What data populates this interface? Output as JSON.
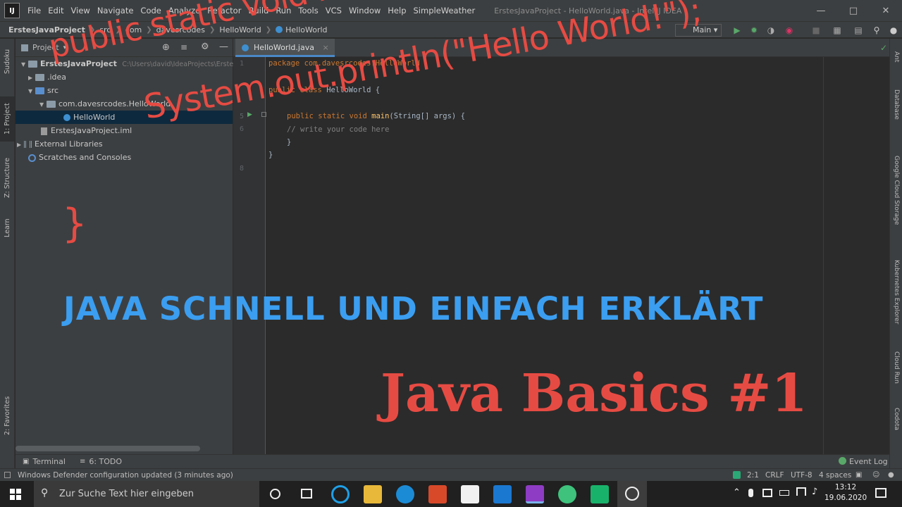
{
  "menu": [
    "File",
    "Edit",
    "View",
    "Navigate",
    "Code",
    "Analyze",
    "Refactor",
    "Build",
    "Run",
    "Tools",
    "VCS",
    "Window",
    "Help",
    "SimpleWeather"
  ],
  "window_title": "ErstesJavaProject - HelloWorld.java - IntelliJ IDEA",
  "app_logo": "IJ",
  "breadcrumbs": [
    "ErstesJavaProject",
    "src",
    "com",
    "davesrcodes",
    "HelloWorld",
    "HelloWorld"
  ],
  "run_config": "Main",
  "left_tabs": [
    "Sudoku",
    "1: Project",
    "Z: Structure",
    "Learn",
    "2: Favorites"
  ],
  "right_tabs": [
    "Ant",
    "Database",
    "Google Cloud Storage",
    "Kubernetes Explorer",
    "Cloud Run",
    "Codota"
  ],
  "project_panel": {
    "title": "Project",
    "tree": [
      {
        "label": "ErstesJavaProject",
        "path": "C:\\Users\\david\\IdeaProjects\\ErstesJ"
      },
      {
        "label": ".idea"
      },
      {
        "label": "src"
      },
      {
        "label": "com.davesrcodes.HelloWorld"
      },
      {
        "label": "HelloWorld"
      },
      {
        "label": "ErstesJavaProject.iml"
      },
      {
        "label": "External Libraries"
      },
      {
        "label": "Scratches and Consoles"
      }
    ]
  },
  "editor": {
    "tab": "HelloWorld.java",
    "line_numbers": [
      "1",
      "5",
      "6",
      "8"
    ],
    "lines": {
      "package": "package com.davesrcodes.HelloWorld",
      "class_kw": "public class",
      "class_name": "HelloWorld {",
      "main_kw": "public static void",
      "main_name": "main",
      "main_args": "(String[] args) {",
      "comment": "// write your code here",
      "close_inner": "}",
      "close_outer": "}"
    }
  },
  "overlay": {
    "line1": "public static void main(String[] args) {",
    "line2": "System.out.println(\"Hello World!\");",
    "brace": "}",
    "subtitle": "JAVA SCHNELL UND EINFACH ERKLÄRT",
    "headline": "Java Basics #1",
    "red": "#e64b43",
    "blue": "#3b9ef0"
  },
  "bottom_tools": {
    "terminal": "Terminal",
    "todo": "6: TODO",
    "event_log": "Event Log"
  },
  "status": {
    "message": "Windows Defender configuration updated (3 minutes ago)",
    "position": "2:1",
    "line_sep": "CRLF",
    "encoding": "UTF-8",
    "indent": "4 spaces"
  },
  "taskbar": {
    "search_placeholder": "Zur Suche Text hier eingeben",
    "time": "13:12",
    "date": "19.06.2020"
  }
}
